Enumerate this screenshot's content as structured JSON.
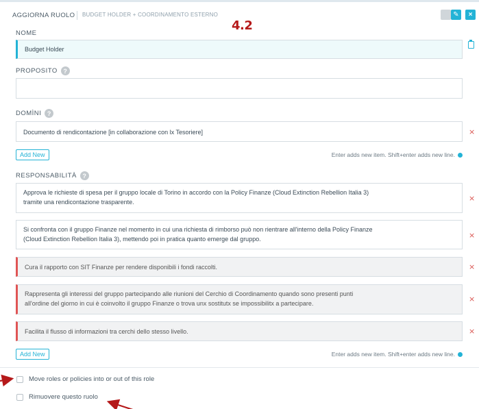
{
  "header": {
    "title": "AGGIORNA RUOLO",
    "subtitle": "BUDGET HOLDER + COORDINAMENTO ESTERNO",
    "annotation": "4.2"
  },
  "nome": {
    "label": "NOME",
    "value": "Budget Holder"
  },
  "proposito": {
    "label": "PROPOSITO",
    "value": ""
  },
  "domini": {
    "label": "DOMÌNI",
    "items": [
      "Documento di rendicontazione [in collaborazione con lx Tesoriere]"
    ],
    "add_new": "Add New",
    "hint": "Enter adds new item. Shift+enter adds new line."
  },
  "responsabilita": {
    "label": "RESPONSABILITÀ",
    "items": [
      "Approva le richieste di spesa per il gruppo locale di Torino in accordo con la Policy Finanze (Cloud Extinction Rebellion Italia 3)\ntramite una rendicontazione trasparente.",
      "Si confronta con il gruppo Finanze nel momento in cui una richiesta di rimborso può non rientrare all'interno della Policy Finanze\n(Cloud Extinction Rebellion Italia 3), mettendo poi in pratica quanto emerge dal gruppo.",
      "Cura il rapporto con SIT Finanze per rendere disponibili i fondi raccolti.",
      "Rappresenta gli interessi del gruppo partecipando alle riunioni del Cerchio di Coordinamento quando sono presenti punti\nall'ordine del giorno in cui è coinvolto il gruppo Finanze o trova unx sostitutx se impossibilitx a partecipare.",
      "Facilita il flusso di informazioni tra cerchi dello stesso livello."
    ],
    "add_new": "Add New",
    "hint": "Enter adds new item. Shift+enter adds new line."
  },
  "options": {
    "move_roles": "Move roles or policies into or out of this role",
    "remove_role": "Rimuovere questo ruolo"
  },
  "icons": {
    "close": "×",
    "edit": "✎",
    "help": "?",
    "remove": "×"
  },
  "colors": {
    "accent": "#23b3d6",
    "danger": "#d9534f",
    "annotation": "#b5191a"
  }
}
